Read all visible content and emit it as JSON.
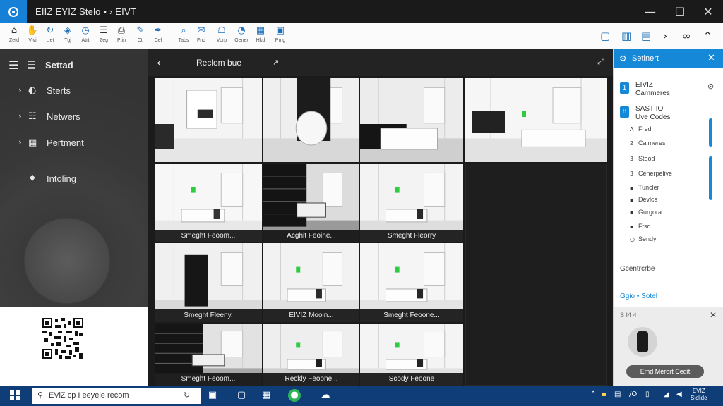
{
  "window": {
    "title": "EIIZ EYIZ Stelo • › EIVT",
    "controls": {
      "minimize": "—",
      "maximize": "☐",
      "close": "✕"
    }
  },
  "toolbar": {
    "tools": [
      {
        "icon": "home-icon",
        "glyph": "⌂",
        "label": "Zetd"
      },
      {
        "icon": "hand-icon",
        "glyph": "✋",
        "label": "Vlvi"
      },
      {
        "icon": "refresh-icon",
        "glyph": "↻",
        "label": "Uet"
      },
      {
        "icon": "tag-icon",
        "glyph": "◈",
        "label": "Tgj"
      },
      {
        "icon": "clock-icon",
        "glyph": "◷",
        "label": "Atrt"
      },
      {
        "icon": "layers-icon",
        "glyph": "☰",
        "label": "Zeg"
      },
      {
        "icon": "print-icon",
        "glyph": "⎙",
        "label": "Ptin"
      },
      {
        "icon": "edit-icon",
        "glyph": "✎",
        "label": "Ctl"
      },
      {
        "icon": "pen-icon",
        "glyph": "✒",
        "label": "Cel"
      },
      {
        "icon": "search-icon",
        "glyph": "⌕",
        "label": "Tabs"
      },
      {
        "icon": "chat-icon",
        "glyph": "✉",
        "label": "Fnd"
      },
      {
        "icon": "shield-icon",
        "glyph": "☖",
        "label": "Vorp"
      },
      {
        "icon": "gauge-icon",
        "glyph": "◔",
        "label": "Gener"
      },
      {
        "icon": "grid-icon",
        "glyph": "▦",
        "label": "Hkd"
      },
      {
        "icon": "image-icon",
        "glyph": "▣",
        "label": "Pmg"
      }
    ],
    "right_tools": [
      {
        "icon": "file-icon",
        "glyph": "▢"
      },
      {
        "icon": "book-icon",
        "glyph": "▥"
      },
      {
        "icon": "doc-icon",
        "glyph": "▤"
      },
      {
        "icon": "chevron-right-icon",
        "glyph": "›"
      },
      {
        "icon": "glasses-icon",
        "glyph": "∞"
      },
      {
        "icon": "collapse-up-icon",
        "glyph": "⌃"
      }
    ]
  },
  "sidebar": {
    "title": "Settad",
    "items": [
      {
        "label": "Sterts",
        "icon": "status-icon",
        "glyph": "◐"
      },
      {
        "label": "Netwers",
        "icon": "network-icon",
        "glyph": "☷"
      },
      {
        "label": "Pertment",
        "icon": "building-icon",
        "glyph": "▦"
      }
    ],
    "extra": {
      "label": "Intoling",
      "icon": "fire-icon",
      "glyph": "♦"
    }
  },
  "content": {
    "title": "Reclom bue",
    "tiles": [
      {
        "scene": "living",
        "caption": ""
      },
      {
        "scene": "chair",
        "caption": ""
      },
      {
        "scene": "bedroom-dark",
        "caption": ""
      },
      {
        "scene": "tv-room",
        "caption": ""
      },
      {
        "scene": "white-room",
        "caption": "Smeght Feoom..."
      },
      {
        "scene": "library",
        "caption": "Acghit Feoine..."
      },
      {
        "scene": "hallway",
        "caption": "Smeght Fleorry"
      },
      {
        "scene": "fridge",
        "caption": "Smeght Fleeny."
      },
      {
        "scene": "bedroom-2",
        "caption": "EIVIZ Mooin..."
      },
      {
        "scene": "bedroom-3",
        "caption": "Smeght Feoone..."
      },
      {
        "scene": "bookshelf",
        "caption": "Smeght Feoom..."
      },
      {
        "scene": "lounge",
        "caption": "Reckly Feoone..."
      },
      {
        "scene": "suite",
        "caption": "Scody Feoone"
      }
    ]
  },
  "right_panel": {
    "title": "Setinert",
    "categories": [
      {
        "num": "1",
        "label": "EIVIZ\nCammeres"
      },
      {
        "num": "8",
        "label": "SAST IO\nUve Codes"
      }
    ],
    "items": [
      {
        "bullet": "A",
        "label": "Fred"
      },
      {
        "bullet": "2",
        "label": "Caimeres"
      },
      {
        "bullet": "3",
        "label": "Stood"
      },
      {
        "bullet": "3",
        "label": "Cenerpelive"
      },
      {
        "bullet": "▪",
        "label": "Tuncler"
      },
      {
        "bullet": "▪",
        "label": "Devlcs"
      },
      {
        "bullet": "▪",
        "label": "Gurgora"
      },
      {
        "bullet": "▪",
        "label": "Ftsd"
      },
      {
        "bullet": "○",
        "label": "Sendy"
      }
    ],
    "section_1": "Gcentrcrbe",
    "section_2": "Ggio • Sotel",
    "camera_card": {
      "label": "S I4 4",
      "button": "Emd Merort Cedit"
    }
  },
  "taskbar": {
    "search_text": "EViZ cp I eeyele recom",
    "clock": "EVIZ\nSlclide",
    "tray_text": "I/O"
  },
  "colors": {
    "accent": "#1588d8",
    "taskbar": "#0f3d78",
    "sidebar": "#3a3a3a",
    "content_bg": "#1b1b1b"
  }
}
